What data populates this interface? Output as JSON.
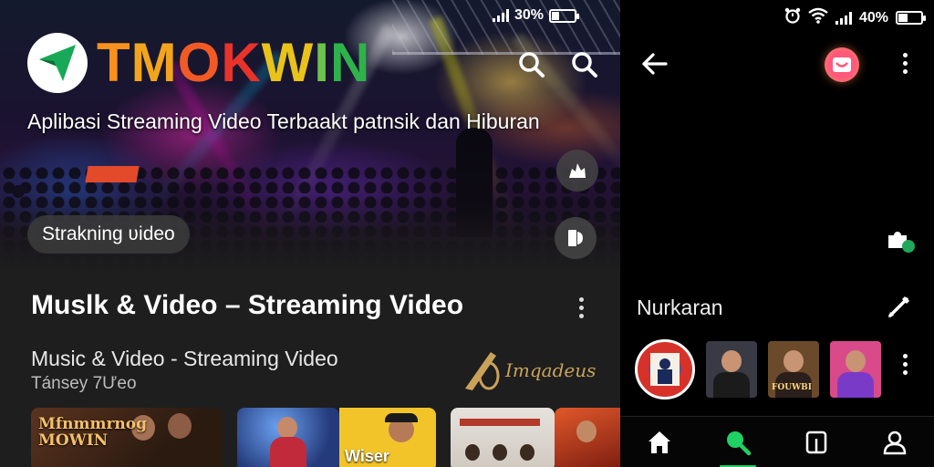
{
  "left_status": {
    "battery": "30%"
  },
  "right_status": {
    "battery": "40%"
  },
  "logo": {
    "letters": [
      "T",
      "M",
      "O",
      "K",
      "W",
      "I",
      "N"
    ],
    "colors": [
      "#f7901e",
      "#f2a51c",
      "#f15a24",
      "#e8332a",
      "#e9c21a",
      "#6cc24a",
      "#2fb24a"
    ]
  },
  "hero": {
    "tagline": "Aplibasi Streaming Video Terbaakt patnsik dan Hiburan",
    "pill_label": "Strakning ʋideo"
  },
  "section": {
    "title": "Muslk & Video – Streaming Video",
    "subtitle": "Music & Video - Streaming Video",
    "meta": "Tánsey 7Ưeo",
    "brand_mark": "Imqadeus"
  },
  "thumbnails": [
    {
      "label": "Mfnmmrnog\nMOWIN",
      "bg": "#4a2a1a"
    },
    {
      "label": "",
      "bg": "#2a3a6a"
    },
    {
      "label": "Wiser",
      "bg": "#f2c42a"
    },
    {
      "label": "",
      "bg": "#d8d4cf"
    },
    {
      "label": "",
      "bg": "#b8321c"
    }
  ],
  "right_panel": {
    "section_label": "Nurkaran",
    "avatars": [
      {
        "caption": "",
        "shirt": "#1b1b1b",
        "bg": "#3a3a44"
      },
      {
        "caption": "FOUWBI",
        "shirt": "#2a1f1a",
        "bg": "#6a4a2a"
      },
      {
        "caption": "",
        "shirt": "#7a3ac8",
        "bg": "#d84a8a"
      }
    ]
  },
  "nav": {
    "items": [
      "home",
      "search",
      "library",
      "profile"
    ],
    "active": "search",
    "accent": "#1fd064"
  }
}
